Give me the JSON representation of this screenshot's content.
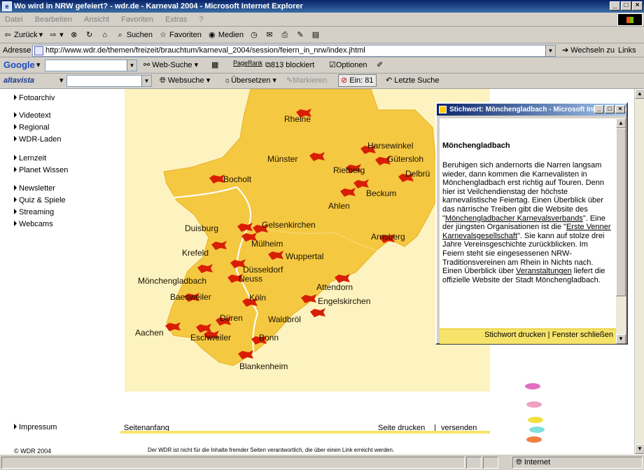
{
  "window": {
    "title": "Wo wird in NRW gefeiert? - wdr.de - Karneval 2004 - Microsoft Internet Explorer",
    "buttons": [
      "_",
      "□",
      "×"
    ]
  },
  "menu": [
    "Datei",
    "Bearbeiten",
    "Ansicht",
    "Favoriten",
    "Extras",
    "?"
  ],
  "toolbar": {
    "back": "Zurück",
    "search": "Suchen",
    "favorites": "Favoriten",
    "media": "Medien"
  },
  "address": {
    "label": "Adresse",
    "url": "http://www.wdr.de/themen/freizeit/brauchtum/karneval_2004/session/feiern_in_nrw/index.jhtml",
    "go": "Wechseln zu",
    "links": "Links"
  },
  "googlebar": {
    "logo": "Google",
    "websearch": "Web-Suche",
    "pagerank": "PageRank",
    "blocked": "813 blockiert",
    "options": "Optionen"
  },
  "altabar": {
    "logo": "altavista",
    "websearch": "Websuche",
    "translate": "Übersetzen",
    "mark": "Markieren",
    "popups": "Ein: 81",
    "last": "Letzte Suche"
  },
  "nav": [
    "Fotoarchiv",
    "Videotext",
    "Regional",
    "WDR-Laden",
    "Lernzeit",
    "Planet Wissen",
    "Newsletter",
    "Quiz & Spiele",
    "Streaming",
    "Webcams",
    "Impressum",
    "© WDR 2004"
  ],
  "map": {
    "cities": [
      "Rheine",
      "Harsewinkel",
      "Münster",
      "Gütersloh",
      "Delbrü",
      "Bocholt",
      "Rietberg",
      "Beckum",
      "Ahlen",
      "Duisburg",
      "Gelsenkirchen",
      "Arnsberg",
      "Mülheim",
      "Krefeld",
      "Wuppertal",
      "Düsseldorf",
      "Mönchengladbach",
      "Neuss",
      "Attendorn",
      "Baesweiler",
      "Köln",
      "Engelskirchen",
      "Düren",
      "Waldbröl",
      "Aachen",
      "Eschweiler",
      "Bonn",
      "Blankenheim"
    ]
  },
  "page": {
    "top": "Seitenanfang",
    "print": "Seite drucken",
    "sep": "|",
    "send": "versenden",
    "disclaimer": "Der WDR ist nicht für die Inhalte fremder Seiten verantwortlich, die über einen Link erreicht werden."
  },
  "popup": {
    "title": "Stichwort: Mönchengladbach - Microsoft Internet Explorer",
    "heading": "Mönchengladbach",
    "text1": "Beruhigen sich andernorts die Narren langsam wieder, dann kommen die Karnevalisten in Mönchengladbach erst richtig auf Touren. Denn hier ist Veilchendienstag der höchste karnevalistische Feiertag. Einen Überblick über das närrische Treiben gibt die Website des \"",
    "link1": "Mönchengladbacher Karnevalsverbands",
    "text2": "\". Eine der jüngsten Organisationen ist die \"",
    "link2": "Erste Venner Karnevalsgesellschaft",
    "text3": "\". Sie kann auf stolze drei Jahre Vereinsgeschichte zurückblicken. Im Feiern steht sie eingesessenen NRW-Traditionsvereinen am Rhein in Nichts nach. Einen Überblick über ",
    "link3": "Veranstaltungen",
    "text4": " liefert die offizielle Website der Stadt Mönchengladbach.",
    "print": "Stichwort drucken",
    "sep": "|",
    "close": "Fenster schließen"
  },
  "status": {
    "zone": "Internet"
  },
  "colors": {
    "map": "#f5c842",
    "flag": "#d81e05",
    "highlight": "#f6e36a",
    "titlebar": "#0a246a"
  }
}
